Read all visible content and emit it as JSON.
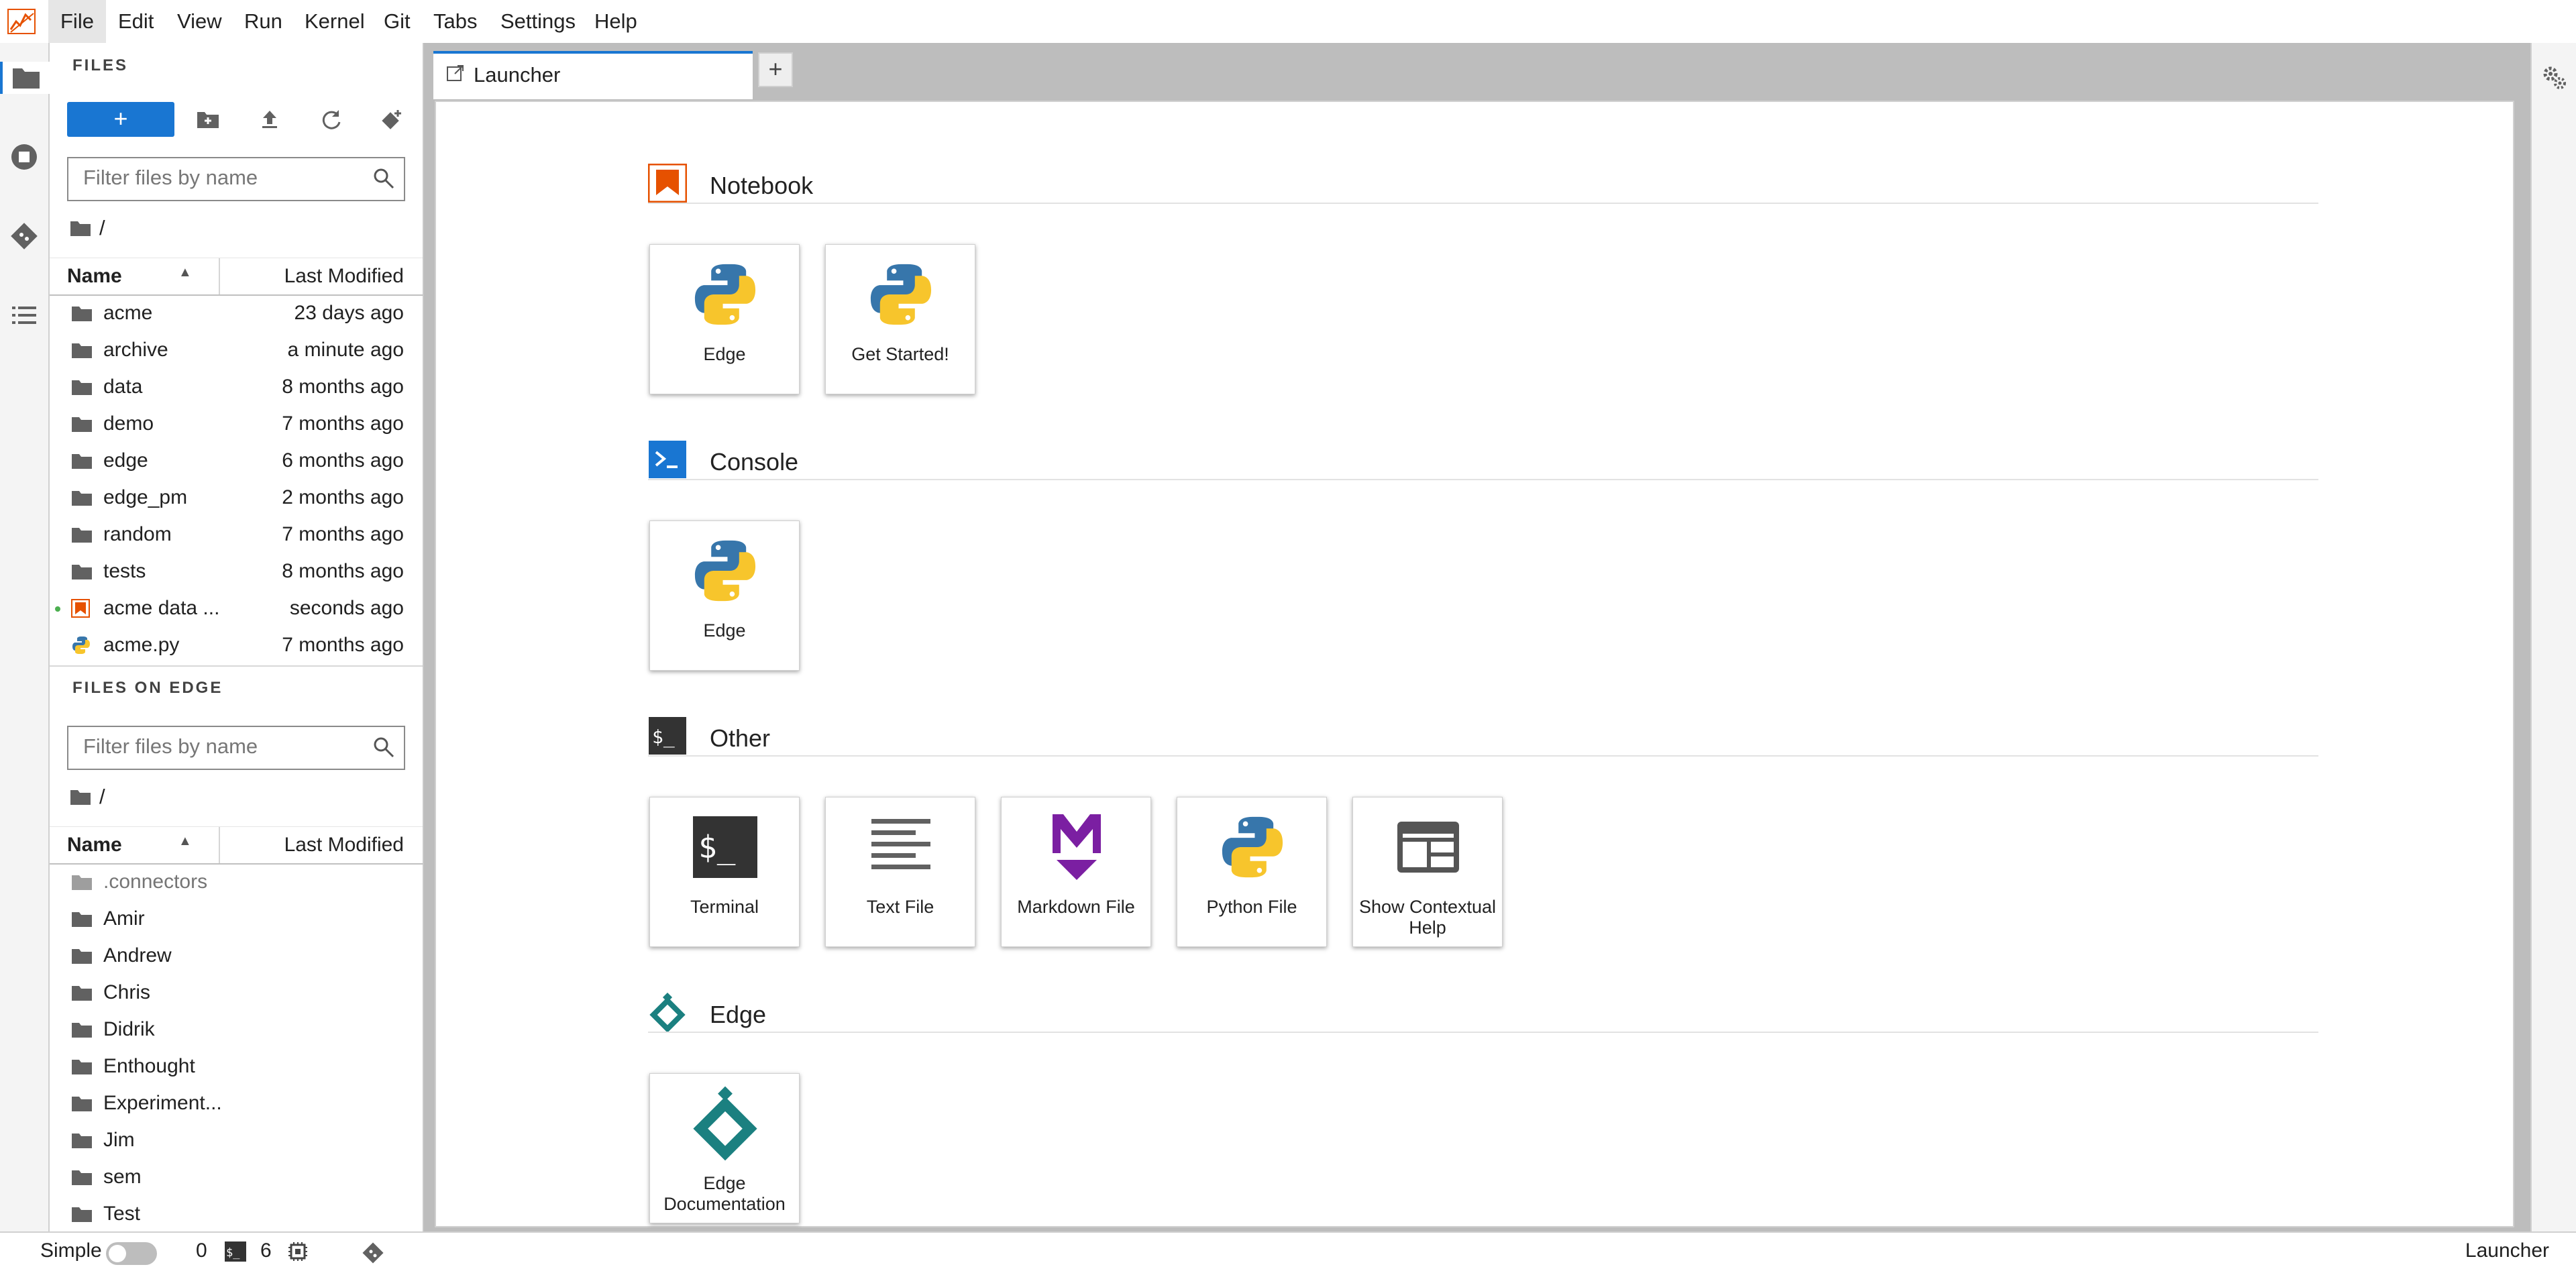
{
  "menu": [
    "File",
    "Edit",
    "View",
    "Run",
    "Kernel",
    "Git",
    "Tabs",
    "Settings",
    "Help"
  ],
  "file_browser": {
    "section_title": "FILES",
    "new_button_label": "+",
    "filter_placeholder": "Filter files by name",
    "breadcrumb": "/",
    "columns": {
      "name": "Name",
      "modified": "Last Modified"
    },
    "rows": [
      {
        "name": "acme",
        "modified": "23 days ago",
        "type": "folder"
      },
      {
        "name": "archive",
        "modified": "a minute ago",
        "type": "folder"
      },
      {
        "name": "data",
        "modified": "8 months ago",
        "type": "folder"
      },
      {
        "name": "demo",
        "modified": "7 months ago",
        "type": "folder"
      },
      {
        "name": "edge",
        "modified": "6 months ago",
        "type": "folder"
      },
      {
        "name": "edge_pm",
        "modified": "2 months ago",
        "type": "folder"
      },
      {
        "name": "random",
        "modified": "7 months ago",
        "type": "folder"
      },
      {
        "name": "tests",
        "modified": "8 months ago",
        "type": "folder"
      },
      {
        "name": "acme data ...",
        "modified": "seconds ago",
        "type": "notebook",
        "running": true
      },
      {
        "name": "acme.py",
        "modified": "7 months ago",
        "type": "python"
      }
    ]
  },
  "edge_browser": {
    "section_title": "FILES ON EDGE",
    "filter_placeholder": "Filter files by name",
    "breadcrumb": "/",
    "columns": {
      "name": "Name",
      "modified": "Last Modified"
    },
    "rows": [
      {
        "name": ".connectors",
        "hidden": true
      },
      {
        "name": "Amir"
      },
      {
        "name": "Andrew"
      },
      {
        "name": "Chris"
      },
      {
        "name": "Didrik"
      },
      {
        "name": "Enthought"
      },
      {
        "name": "Experiment..."
      },
      {
        "name": "Jim"
      },
      {
        "name": "sem"
      },
      {
        "name": "Test"
      }
    ]
  },
  "tabs": [
    {
      "label": "Launcher"
    }
  ],
  "add_tab_label": "+",
  "launcher": {
    "sections": [
      {
        "title": "Notebook",
        "icon": "notebook-icon",
        "color": "#e65100",
        "items": [
          {
            "label": "Edge",
            "icon": "python-icon"
          },
          {
            "label": "Get Started!",
            "icon": "python-icon"
          }
        ]
      },
      {
        "title": "Console",
        "icon": "console-icon",
        "color": "#1976d2",
        "items": [
          {
            "label": "Edge",
            "icon": "python-icon"
          }
        ]
      },
      {
        "title": "Other",
        "icon": "terminal-icon",
        "color": "#333333",
        "items": [
          {
            "label": "Terminal",
            "icon": "terminal-icon"
          },
          {
            "label": "Text File",
            "icon": "text-file-icon"
          },
          {
            "label": "Markdown File",
            "icon": "markdown-icon"
          },
          {
            "label": "Python File",
            "icon": "python-icon"
          },
          {
            "label": "Show Contextual Help",
            "icon": "contextual-help-icon"
          }
        ]
      },
      {
        "title": "Edge",
        "icon": "edge-logo-icon",
        "color": "#1b8080",
        "items": [
          {
            "label": "Edge Documentation",
            "icon": "edge-logo-icon"
          }
        ]
      }
    ]
  },
  "status": {
    "mode_label": "Simple",
    "simple_mode": false,
    "kernels_count": "0",
    "terminals_count": "6",
    "right_label": "Launcher"
  },
  "colors": {
    "accent": "#1976d2",
    "orange": "#e65100",
    "teal": "#1b8080",
    "purple": "#7b1fa2"
  }
}
